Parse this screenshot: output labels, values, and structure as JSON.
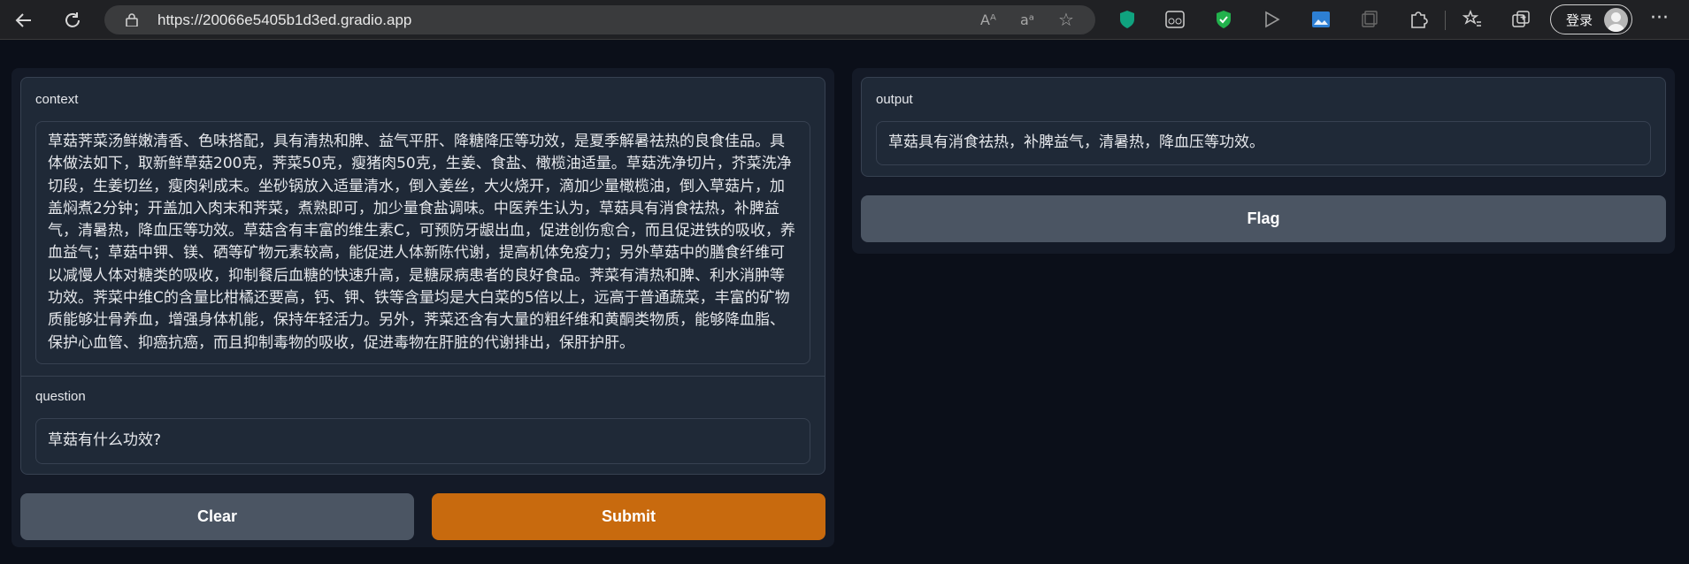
{
  "browser": {
    "url": "https://20066e5405b1d3ed.gradio.app",
    "read_aloud": "Aᴬ",
    "translate": "aᵃ",
    "login_label": "登录"
  },
  "icons": {
    "back": "back-arrow-icon",
    "refresh": "refresh-icon",
    "lock": "lock-icon",
    "favorite": "add-favorite-icon",
    "more": "more-icon"
  },
  "inputs": {
    "context_label": "context",
    "context_value": "草菇荠菜汤鲜嫩清香、色味搭配，具有清热和脾、益气平肝、降糖降压等功效，是夏季解暑祛热的良食佳品。具体做法如下，取新鲜草菇200克，荠菜50克，瘦猪肉50克，生姜、食盐、橄榄油适量。草菇洗净切片，芥菜洗净切段，生姜切丝，瘦肉剁成末。坐砂锅放入适量清水，倒入姜丝，大火烧开，滴加少量橄榄油，倒入草菇片，加盖焖煮2分钟；开盖加入肉末和荠菜，煮熟即可，加少量食盐调味。中医养生认为，草菇具有消食祛热，补脾益气，清暑热，降血压等功效。草菇含有丰富的维生素C，可预防牙龈出血，促进创伤愈合，而且促进铁的吸收，养血益气；草菇中钾、镁、硒等矿物元素较高，能促进人体新陈代谢，提高机体免疫力；另外草菇中的膳食纤维可以减慢人体对糖类的吸收，抑制餐后血糖的快速升高，是糖尿病患者的良好食品。荠菜有清热和脾、利水消肿等功效。荠菜中维C的含量比柑橘还要高，钙、钾、铁等含量均是大白菜的5倍以上，远高于普通蔬菜，丰富的矿物质能够壮骨养血，增强身体机能，保持年轻活力。另外，荠菜还含有大量的粗纤维和黄酮类物质，能够降血脂、保护心血管、抑癌抗癌，而且抑制毒物的吸收，促进毒物在肝脏的代谢排出，保肝护肝。",
    "question_label": "question",
    "question_value": "草菇有什么功效?"
  },
  "buttons": {
    "clear": "Clear",
    "submit": "Submit",
    "flag": "Flag"
  },
  "output": {
    "label": "output",
    "value": "草菇具有消食祛热，补脾益气，清暑热，降血压等功效。"
  },
  "colors": {
    "submit_bg": "#c86a0e",
    "secondary_bg": "#4b5563",
    "page_bg": "#0b0f19"
  }
}
